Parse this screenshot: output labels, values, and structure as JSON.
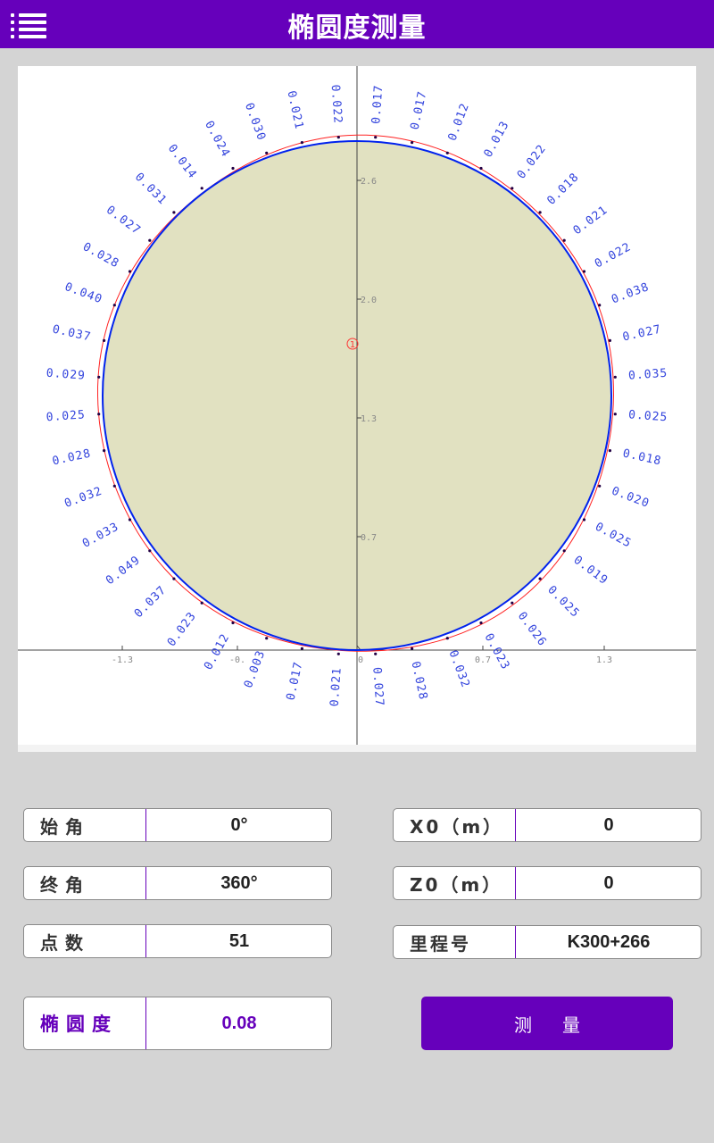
{
  "app": {
    "title": "椭圆度测量"
  },
  "colors": {
    "brand": "#6600bb",
    "fill": "#e1e1c1",
    "fitted_circle": "#0022ee",
    "measured_curve": "#ff2222",
    "labels": "#3344dd"
  },
  "icons": {
    "menu": "menu-icon"
  },
  "form": {
    "start_angle": {
      "label": "始角",
      "value": "0°"
    },
    "end_angle": {
      "label": "终角",
      "value": "360°"
    },
    "point_count": {
      "label": "点数",
      "value": "51"
    },
    "x0": {
      "label": "X0（m）",
      "value": "0"
    },
    "z0": {
      "label": "Z0（m）",
      "value": "0"
    },
    "mileage": {
      "label": "里程号",
      "value": "K300+266"
    },
    "ovality": {
      "label": "椭圆度",
      "value": "0.08"
    },
    "measure_button": "测量"
  },
  "chart_data": {
    "type": "scatter",
    "x_ticks": [
      "-1.3",
      "-0.",
      "0",
      "0.7",
      "1.3"
    ],
    "y_ticks": [
      "0.7",
      "1.3",
      "2.0",
      "2.6"
    ],
    "center_marker": "1",
    "deviation_labels_clockwise_from_top": [
      "0.017",
      "0.017",
      "0.012",
      "0.013",
      "0.022",
      "0.018",
      "0.021",
      "0.022",
      "0.038",
      "0.027",
      "0.035",
      "0.025",
      "0.018",
      "0.020",
      "0.025",
      "0.019",
      "0.025",
      "0.026",
      "0.023",
      "0.032",
      "0.028",
      "0.027",
      "0.021",
      "0.017",
      "0.003",
      "0.012",
      "0.023",
      "0.037",
      "0.049",
      "0.033",
      "0.032",
      "0.028",
      "0.025",
      "0.029",
      "0.037",
      "0.040",
      "0.028",
      "0.027",
      "0.031",
      "0.014",
      "0.024",
      "0.030",
      "0.021",
      "0.022"
    ]
  }
}
